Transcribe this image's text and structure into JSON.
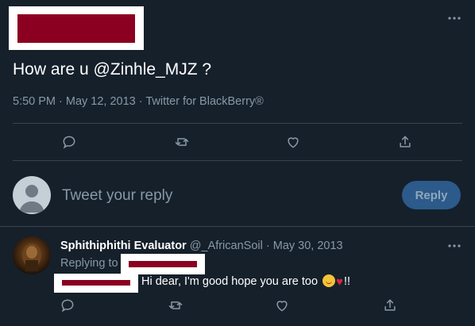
{
  "main_tweet": {
    "text": "How are u @Zinhle_MJZ ?",
    "meta": "5:50 PM · May 12, 2013 · Twitter for BlackBerry®",
    "more_label": "···"
  },
  "compose": {
    "placeholder": "Tweet your reply",
    "reply_button": "Reply"
  },
  "reply_tweet": {
    "name": "Sphithiphithi Evaluator",
    "handle": "@_AfricanSoil",
    "separator": "·",
    "date": "May 30, 2013",
    "replying_to_label": "Replying to",
    "body": "Hi dear, I'm good hope you are too",
    "suffix": "!!",
    "more_label": "···"
  },
  "colors": {
    "background": "#15202b",
    "muted": "#8899a6",
    "divider": "#38444d",
    "redaction": "#8b0020",
    "reply_button": "#2c5a8a"
  },
  "icons": [
    "reply-icon",
    "retweet-icon",
    "like-icon",
    "share-icon",
    "default-avatar-icon",
    "more-icon"
  ]
}
